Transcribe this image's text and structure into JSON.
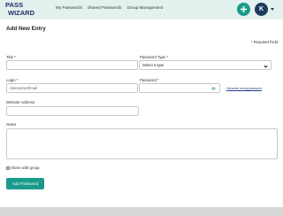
{
  "app": {
    "logo_top": "PASS",
    "logo_bottom": "WIZARD"
  },
  "nav": {
    "items": [
      "My Passwords",
      "Shared Passwords",
      "Group Management"
    ]
  },
  "header": {
    "add_icon": "plus-icon",
    "avatar_initial": "K"
  },
  "page": {
    "title": "Add New Entry",
    "required_note": "* Required Field"
  },
  "form": {
    "title_label": "Title *",
    "title_value": "",
    "password_type_label": "Password Type *",
    "password_type_value": "Select a type",
    "login_label": "Login *",
    "login_placeholder": "Username/Email",
    "password_label": "Password *",
    "password_value": "",
    "generate_link": "Generate strong password",
    "website_label": "Website Address",
    "website_value": "",
    "notes_label": "Notes",
    "notes_value": "",
    "share_label": "Share with group",
    "submit_label": "Add Password"
  },
  "colors": {
    "accent": "#1a9b8c",
    "brand_dark": "#2d2566",
    "avatar_bg": "#1e3a5f",
    "topbar_bg": "#e3f2ef"
  }
}
